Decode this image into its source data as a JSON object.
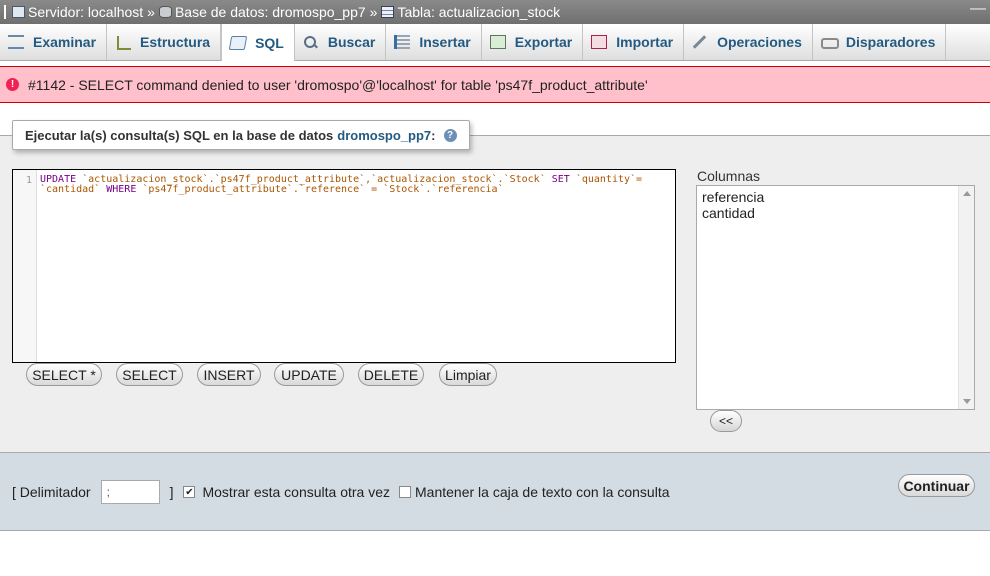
{
  "breadcrumb": {
    "server": "Servidor: localhost",
    "database": "Base de datos: dromospo_pp7",
    "table": "Tabla: actualizacion_stock",
    "separator": "»"
  },
  "tabs": [
    {
      "label": "Examinar",
      "icon": "browse-icon"
    },
    {
      "label": "Estructura",
      "icon": "structure-icon"
    },
    {
      "label": "SQL",
      "icon": "sql-icon",
      "active": true
    },
    {
      "label": "Buscar",
      "icon": "search-icon"
    },
    {
      "label": "Insertar",
      "icon": "insert-icon"
    },
    {
      "label": "Exportar",
      "icon": "export-icon"
    },
    {
      "label": "Importar",
      "icon": "import-icon"
    },
    {
      "label": "Operaciones",
      "icon": "wrench-icon"
    },
    {
      "label": "Disparadores",
      "icon": "trigger-icon"
    }
  ],
  "error": {
    "message": "#1142 - SELECT command denied to user 'dromospo'@'localhost' for table 'ps47f_product_attribute'"
  },
  "query_box": {
    "legend": "Ejecutar la(s) consulta(s) SQL en la base de datos",
    "database": "dromospo_pp7",
    "colon": ":",
    "line_number": "1",
    "sql_line1_kw": "UPDATE",
    "sql_line1_rest": " `actualizacion_stock`.`ps47f_product_attribute`,`actualizacion_stock`.`Stock` ",
    "sql_line1_kw2": "SET",
    "sql_line1_end": " `quantity`=",
    "sql_line2_start": "`cantidad` ",
    "sql_line2_kw": "WHERE",
    "sql_line2_rest": " `ps47f_product_attribute`.`reference` = `Stock`.`referencia`"
  },
  "buttons": [
    "SELECT *",
    "SELECT",
    "INSERT",
    "UPDATE",
    "DELETE",
    "Limpiar"
  ],
  "columns": {
    "label": "Columnas",
    "items": [
      "referencia",
      "cantidad"
    ],
    "insert_button": "<<"
  },
  "footer": {
    "delimiter_label": "[ Delimitador",
    "delimiter_value": ";",
    "delimiter_close": "]",
    "show_query_label": "Mostrar esta consulta otra vez",
    "show_query_checked": true,
    "keep_box_label": "Mantener la caja de texto con la consulta",
    "keep_box_checked": false,
    "continue_label": "Continuar"
  },
  "colors": {
    "error_bg": "#ffc0cb",
    "error_text": "#cc0000",
    "link": "#235a81",
    "footer_bg": "#d3dce3"
  }
}
